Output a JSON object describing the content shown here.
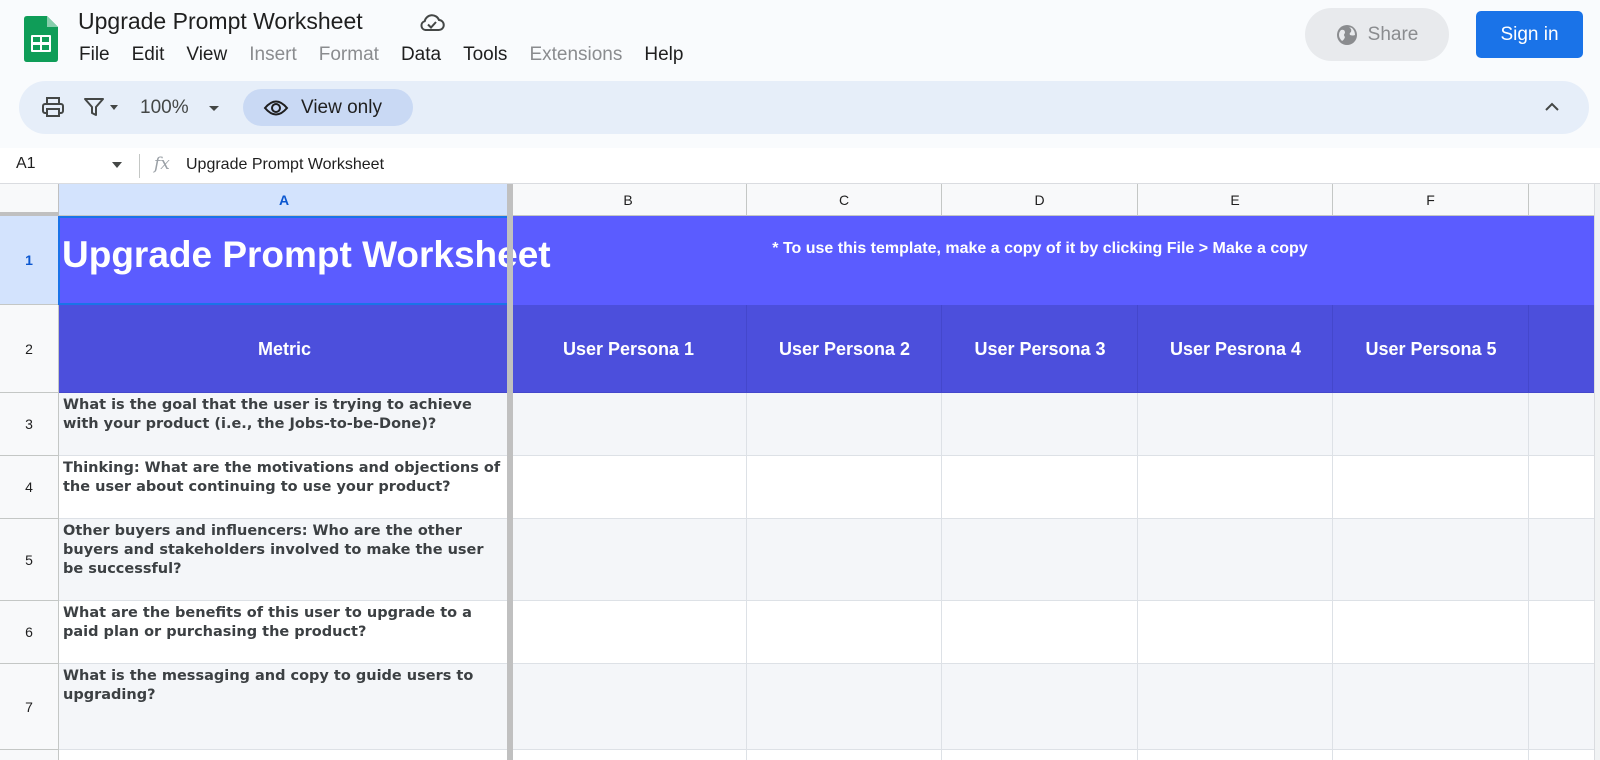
{
  "header": {
    "title": "Upgrade Prompt Worksheet",
    "menu": [
      {
        "label": "File",
        "enabled": true
      },
      {
        "label": "Edit",
        "enabled": true
      },
      {
        "label": "View",
        "enabled": true
      },
      {
        "label": "Insert",
        "enabled": false
      },
      {
        "label": "Format",
        "enabled": false
      },
      {
        "label": "Data",
        "enabled": true
      },
      {
        "label": "Tools",
        "enabled": true
      },
      {
        "label": "Extensions",
        "enabled": false
      },
      {
        "label": "Help",
        "enabled": true
      }
    ],
    "share_label": "Share",
    "signin_label": "Sign in"
  },
  "toolbar": {
    "zoom": "100%",
    "view_only_label": "View only"
  },
  "formula_bar": {
    "cell_ref": "A1",
    "content": "Upgrade Prompt Worksheet"
  },
  "sheet": {
    "columns": [
      "A",
      "B",
      "C",
      "D",
      "E",
      "F",
      ""
    ],
    "rows": [
      "1",
      "2",
      "3",
      "4",
      "5",
      "6",
      "7",
      ""
    ],
    "title": "Upgrade Prompt Worksheet",
    "note": "* To use this template, make a copy of it by clicking File > Make a copy",
    "headers": [
      "Metric",
      "User Persona 1",
      "User Persona 2",
      "User Persona 3",
      "User Pesrona 4",
      "User Persona 5"
    ],
    "questions": [
      "What is the goal that the user is trying to achieve with your product (i.e., the Jobs-to-be-Done)?",
      "Thinking: What are the motivations and objections of the user about continuing to use your product?",
      "Other buyers and influencers: Who are the other buyers and stakeholders involved to make the user be successful?",
      "What are the benefits of this user to upgrade to a paid plan or purchasing the product?",
      "What is the messaging and copy to guide users to upgrading?"
    ]
  },
  "colors": {
    "title_row": "#5b5cff",
    "header_row": "#4c4fdc",
    "accent": "#1a73e8",
    "sheets_green": "#0f9d58"
  }
}
